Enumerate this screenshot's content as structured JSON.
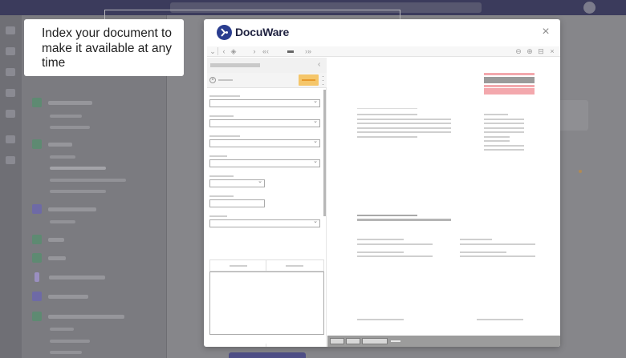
{
  "callout": {
    "text": "Index your document to make it available at any time"
  },
  "modal": {
    "brand": "DocuWare",
    "close_glyph": "×",
    "toolbar": {
      "chevron_down": "⌄",
      "prev": "‹",
      "next": "›",
      "first": "«‹",
      "last": "›»",
      "zoom_out": "⊖",
      "zoom_in": "⊕"
    }
  },
  "colors": {
    "brand": "#2a3d8f",
    "store_button": "#f5c66a",
    "stamp_red": "#f3a8ad",
    "stamp_gray": "#9a9a9a"
  },
  "icons": [
    "docuware-logo-icon",
    "close-icon",
    "chevron-down-icon",
    "chevron-left-icon",
    "zoom-out-icon",
    "zoom-in-icon",
    "clear-icon",
    "more-icon"
  ]
}
